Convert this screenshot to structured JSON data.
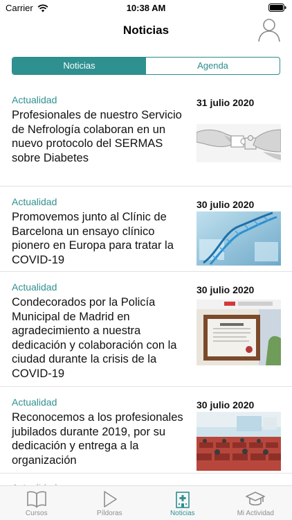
{
  "status_bar": {
    "carrier": "Carrier",
    "time": "10:38 AM"
  },
  "header": {
    "title": "Noticias"
  },
  "segments": {
    "noticias": "Noticias",
    "agenda": "Agenda",
    "selected": "Noticias"
  },
  "news": [
    {
      "category": "Actualidad",
      "headline": "Profesionales de nuestro Servicio de Nefrología colaboran en un nuevo protocolo del SERMAS sobre Diabetes",
      "date": "31 julio 2020",
      "image": "puzzle-hands"
    },
    {
      "category": "Actualidad",
      "headline": "Promovemos junto al Clínic de Barcelona un ensayo clínico pionero en Europa para tratar la COVID-19",
      "date": "30 julio 2020",
      "image": "dna-lab"
    },
    {
      "category": "Actualidad",
      "headline": "Condecorados por la Policía Municipal de Madrid en agradecimiento a nuestra dedicación y colaboración con la ciudad durante la crisis de la COVID-19",
      "date": "30 julio 2020",
      "image": "framed-diploma"
    },
    {
      "category": "Actualidad",
      "headline": "Reconocemos a los profesionales jubilados durante 2019, por su dedicación y entrega a la organización",
      "date": "30 julio 2020",
      "image": "auditorium"
    },
    {
      "category": "Actualidad",
      "headline": "",
      "date": "",
      "image": ""
    }
  ],
  "tabbar": {
    "cursos": "Cursos",
    "pildoras": "Píldoras",
    "noticias": "Noticias",
    "mi_actividad": "Mi Actividad",
    "active": "Noticias"
  },
  "colors": {
    "accent": "#2f9090",
    "inactive": "#8e8e8e",
    "separator": "#e2e2e2"
  }
}
